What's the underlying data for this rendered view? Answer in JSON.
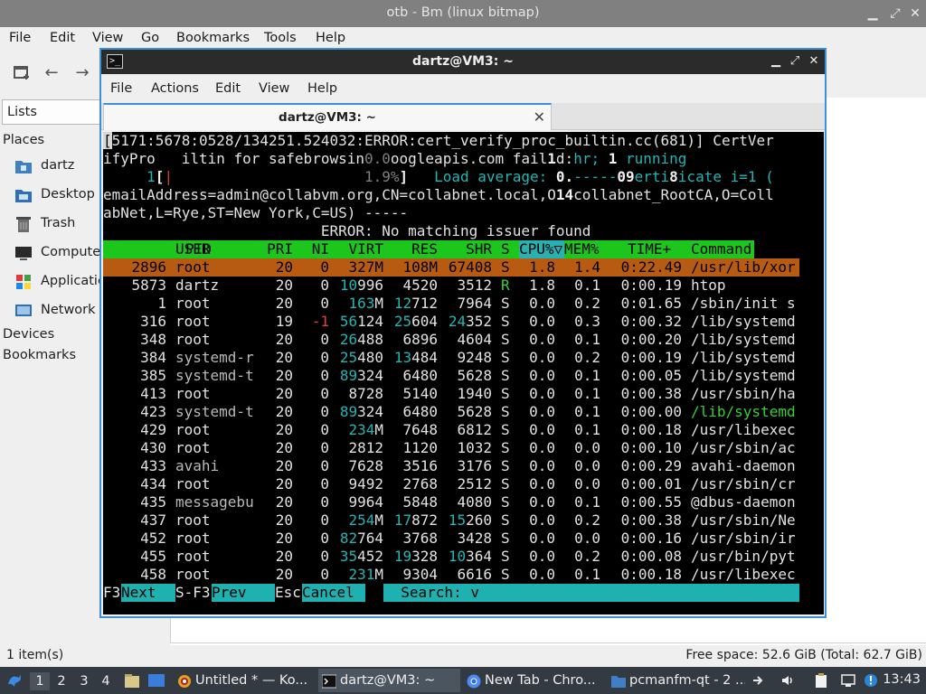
{
  "file_manager": {
    "title": "otb - Bm (linux bitmap)",
    "menu": [
      "File",
      "Edit",
      "View",
      "Go",
      "Bookmarks",
      "Tools",
      "Help"
    ],
    "sidebar": {
      "lists_label": "Lists",
      "places_heading": "Places",
      "places": [
        "dartz",
        "Desktop",
        "Trash",
        "Computer",
        "Applications",
        "Network"
      ],
      "devices_heading": "Devices",
      "bookmarks_heading": "Bookmarks"
    },
    "status_left": "1 item(s)",
    "status_right": "Free space: 52.6 GiB (Total: 62.7 GiB)"
  },
  "taskbar": {
    "workspaces": [
      "1",
      "2",
      "3",
      "4"
    ],
    "tasks": [
      {
        "label": "Untitled * — Ko...",
        "icon": "konqueror-icon"
      },
      {
        "label": "dartz@VM3: ~",
        "icon": "terminal-icon"
      },
      {
        "label": "New Tab - Chro...",
        "icon": "chromium-icon"
      },
      {
        "label": "pcmanfm-qt - 2 ...",
        "icon": "folder-icon"
      }
    ],
    "clock": "13:43"
  },
  "terminal": {
    "title": "dartz@VM3: ~",
    "menu": [
      "File",
      "Actions",
      "Edit",
      "View",
      "Help"
    ],
    "tab_label": "dartz@VM3: ~"
  },
  "htop": {
    "line1": "5171:5678:0528/134251.524032:ERROR:cert_verify_proc_builtin.cc(681)] CertVer",
    "line1_cursor": "[",
    "line2": {
      "a": "ifyPro   iltin for safebrowsin",
      "b": "0.0",
      "c": "oogleapis.com fail",
      "d": "1",
      "e": "d:",
      "f": "hr; ",
      "g": "1",
      "h": " running"
    },
    "line3": {
      "a": "     1",
      "b": "[",
      "c": "|",
      "d": "                      ",
      "e": "1.9%",
      "f": "]   ",
      "g": "Load average: ",
      "h": "0.",
      "i": "-----",
      "j": "09",
      "k": "erti",
      "l": "8",
      "m": "icate i=1 ("
    },
    "line4": {
      "a": "emailAddress=admin@collabvm.org,CN=collabnet.local,O",
      "b": "14",
      "c": "collabnet_RootCA,O=Coll"
    },
    "line5": "abNet,L=Rye,ST=New York,C=US) -----",
    "line6": "                         ERROR: No matching issuer found",
    "header": {
      "pid": "PID",
      "user": "USER",
      "pri": "PRI",
      "ni": "NI",
      "virt": "VIRT",
      "res": "RES",
      "shr": "SHR",
      "s": "S",
      "cpu": "CPU%▽",
      "mem": "MEM%",
      "time": "TIME+",
      "cmd": "Command"
    },
    "processes": [
      {
        "pid": "2896",
        "user": "root",
        "pri": "20",
        "ni": "0",
        "virt": "327M",
        "res": "108M",
        "shr": "67408",
        "s": "S",
        "cpu": "1.8",
        "mem": "1.4",
        "time": "0:22.49",
        "cmd": "/usr/lib/xor",
        "selected": true
      },
      {
        "pid": "5873",
        "user": "dartz",
        "pri": "20",
        "ni": "0",
        "virt": "10996",
        "res": "4520",
        "shr": "3512",
        "s": "R",
        "cpu": "1.8",
        "mem": "0.1",
        "time": "0:00.19",
        "cmd": "htop"
      },
      {
        "pid": "1",
        "user": "root",
        "pri": "20",
        "ni": "0",
        "virt": "163M",
        "res": "12712",
        "shr": "7964",
        "s": "S",
        "cpu": "0.0",
        "mem": "0.2",
        "time": "0:01.65",
        "cmd": "/sbin/init s"
      },
      {
        "pid": "316",
        "user": "root",
        "pri": "19",
        "ni": "-1",
        "virt": "56124",
        "res": "25604",
        "shr": "24352",
        "s": "S",
        "cpu": "0.0",
        "mem": "0.3",
        "time": "0:00.32",
        "cmd": "/lib/systemd"
      },
      {
        "pid": "348",
        "user": "root",
        "pri": "20",
        "ni": "0",
        "virt": "26488",
        "res": "6896",
        "shr": "4604",
        "s": "S",
        "cpu": "0.0",
        "mem": "0.1",
        "time": "0:00.20",
        "cmd": "/lib/systemd"
      },
      {
        "pid": "384",
        "user": "systemd-r",
        "pri": "20",
        "ni": "0",
        "virt": "25480",
        "res": "13484",
        "shr": "9248",
        "s": "S",
        "cpu": "0.0",
        "mem": "0.2",
        "time": "0:00.19",
        "cmd": "/lib/systemd"
      },
      {
        "pid": "385",
        "user": "systemd-t",
        "pri": "20",
        "ni": "0",
        "virt": "89324",
        "res": "6480",
        "shr": "5628",
        "s": "S",
        "cpu": "0.0",
        "mem": "0.1",
        "time": "0:00.05",
        "cmd": "/lib/systemd"
      },
      {
        "pid": "413",
        "user": "root",
        "pri": "20",
        "ni": "0",
        "virt": "8728",
        "res": "5140",
        "shr": "1940",
        "s": "S",
        "cpu": "0.0",
        "mem": "0.1",
        "time": "0:00.38",
        "cmd": "/usr/sbin/ha"
      },
      {
        "pid": "423",
        "user": "systemd-t",
        "pri": "20",
        "ni": "0",
        "virt": "89324",
        "res": "6480",
        "shr": "5628",
        "s": "S",
        "cpu": "0.0",
        "mem": "0.1",
        "time": "0:00.00",
        "cmd": "/lib/systemd",
        "thread": true
      },
      {
        "pid": "429",
        "user": "root",
        "pri": "20",
        "ni": "0",
        "virt": "234M",
        "res": "7648",
        "shr": "6812",
        "s": "S",
        "cpu": "0.0",
        "mem": "0.1",
        "time": "0:00.18",
        "cmd": "/usr/libexec"
      },
      {
        "pid": "430",
        "user": "root",
        "pri": "20",
        "ni": "0",
        "virt": "2812",
        "res": "1120",
        "shr": "1032",
        "s": "S",
        "cpu": "0.0",
        "mem": "0.0",
        "time": "0:00.10",
        "cmd": "/usr/sbin/ac"
      },
      {
        "pid": "433",
        "user": "avahi",
        "pri": "20",
        "ni": "0",
        "virt": "7628",
        "res": "3516",
        "shr": "3176",
        "s": "S",
        "cpu": "0.0",
        "mem": "0.0",
        "time": "0:00.29",
        "cmd": "avahi-daemon"
      },
      {
        "pid": "434",
        "user": "root",
        "pri": "20",
        "ni": "0",
        "virt": "9492",
        "res": "2768",
        "shr": "2512",
        "s": "S",
        "cpu": "0.0",
        "mem": "0.0",
        "time": "0:00.01",
        "cmd": "/usr/sbin/cr"
      },
      {
        "pid": "435",
        "user": "messagebu",
        "pri": "20",
        "ni": "0",
        "virt": "9964",
        "res": "5848",
        "shr": "4080",
        "s": "S",
        "cpu": "0.0",
        "mem": "0.1",
        "time": "0:00.55",
        "cmd": "@dbus-daemon"
      },
      {
        "pid": "437",
        "user": "root",
        "pri": "20",
        "ni": "0",
        "virt": "254M",
        "res": "17872",
        "shr": "15260",
        "s": "S",
        "cpu": "0.0",
        "mem": "0.2",
        "time": "0:00.38",
        "cmd": "/usr/sbin/Ne"
      },
      {
        "pid": "452",
        "user": "root",
        "pri": "20",
        "ni": "0",
        "virt": "82764",
        "res": "3768",
        "shr": "3428",
        "s": "S",
        "cpu": "0.0",
        "mem": "0.0",
        "time": "0:00.16",
        "cmd": "/usr/sbin/ir"
      },
      {
        "pid": "455",
        "user": "root",
        "pri": "20",
        "ni": "0",
        "virt": "35452",
        "res": "19328",
        "shr": "10364",
        "s": "S",
        "cpu": "0.0",
        "mem": "0.2",
        "time": "0:00.08",
        "cmd": "/usr/bin/pyt"
      },
      {
        "pid": "458",
        "user": "root",
        "pri": "20",
        "ni": "0",
        "virt": "231M",
        "res": "9304",
        "shr": "6616",
        "s": "S",
        "cpu": "0.0",
        "mem": "0.1",
        "time": "0:00.18",
        "cmd": "/usr/libexec"
      }
    ],
    "footer": {
      "f3_key": "F3",
      "f3_label": "Next",
      "sf3_key": "S-F3",
      "sf3_label": "Prev",
      "esc_key": "Esc",
      "esc_label": "Cancel",
      "search_label": "  Search: ",
      "search_value": "v"
    }
  },
  "colors": {
    "accent": "#3c8fd8",
    "htop_header": "#1cc61c",
    "htop_selected": "#b85b12",
    "htop_cyan": "#23b5b5"
  }
}
